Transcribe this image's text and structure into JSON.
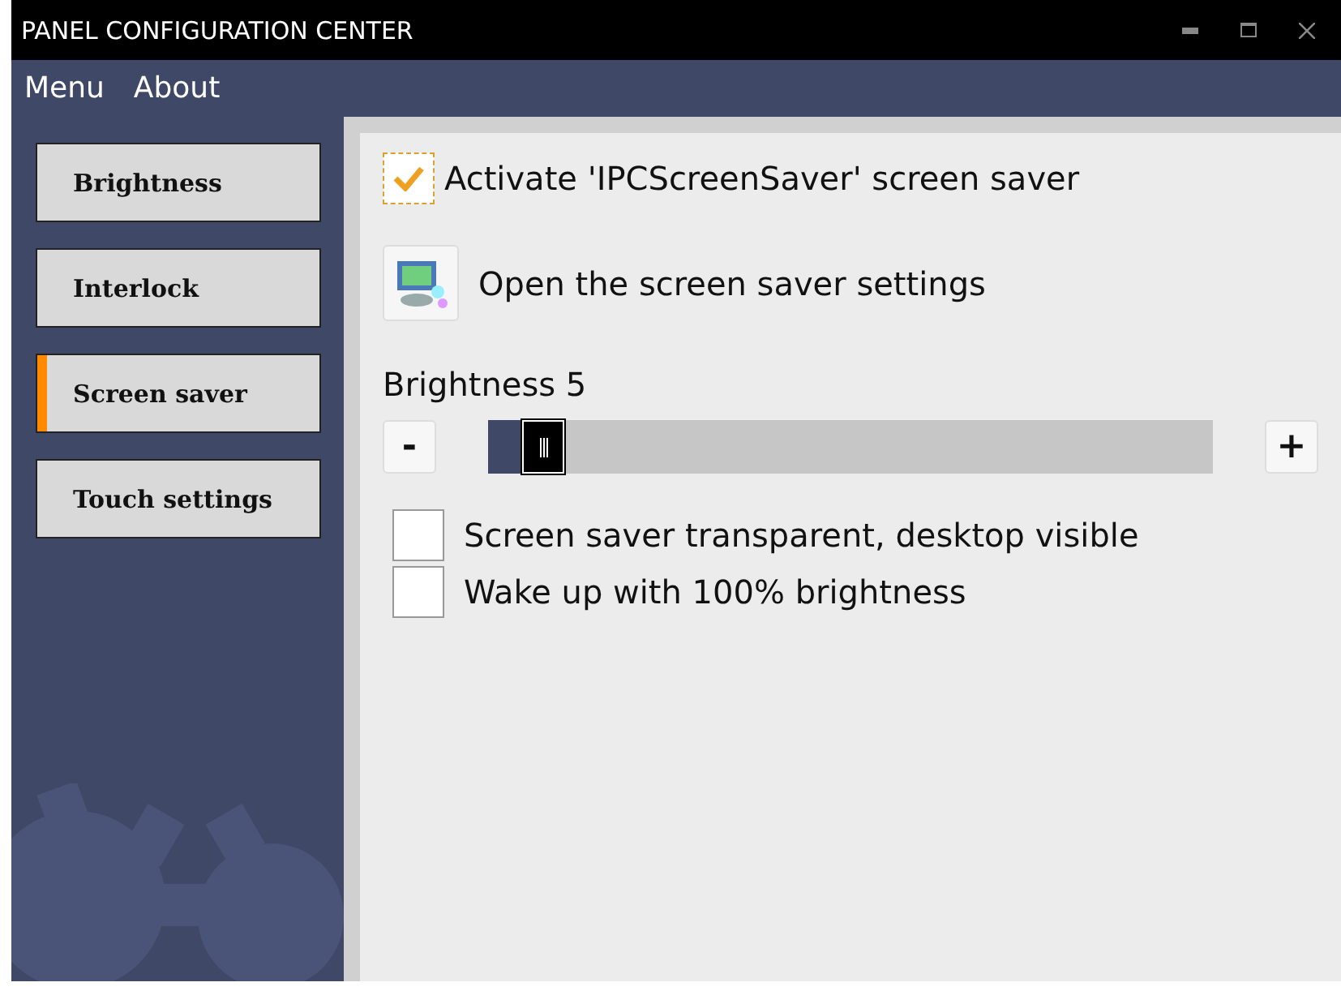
{
  "window": {
    "title": "PANEL CONFIGURATION CENTER"
  },
  "menu": [
    "Menu",
    "About"
  ],
  "sidebar": {
    "items": [
      {
        "label": "Brightness",
        "selected": false
      },
      {
        "label": "Interlock",
        "selected": false
      },
      {
        "label": "Screen saver",
        "selected": true
      },
      {
        "label": "Touch settings",
        "selected": false
      }
    ]
  },
  "activate": {
    "label": "Activate 'IPCScreenSaver' screen saver",
    "checked": true
  },
  "settings_button": {
    "label": "Open the screen saver settings"
  },
  "brightness": {
    "label": "Brightness 5",
    "minus": "-",
    "plus": "+",
    "level": 0.05
  },
  "options": [
    {
      "label": "Screen saver transparent, desktop visible",
      "checked": false
    },
    {
      "label": "Wake up with 100% brightness",
      "checked": false
    }
  ]
}
